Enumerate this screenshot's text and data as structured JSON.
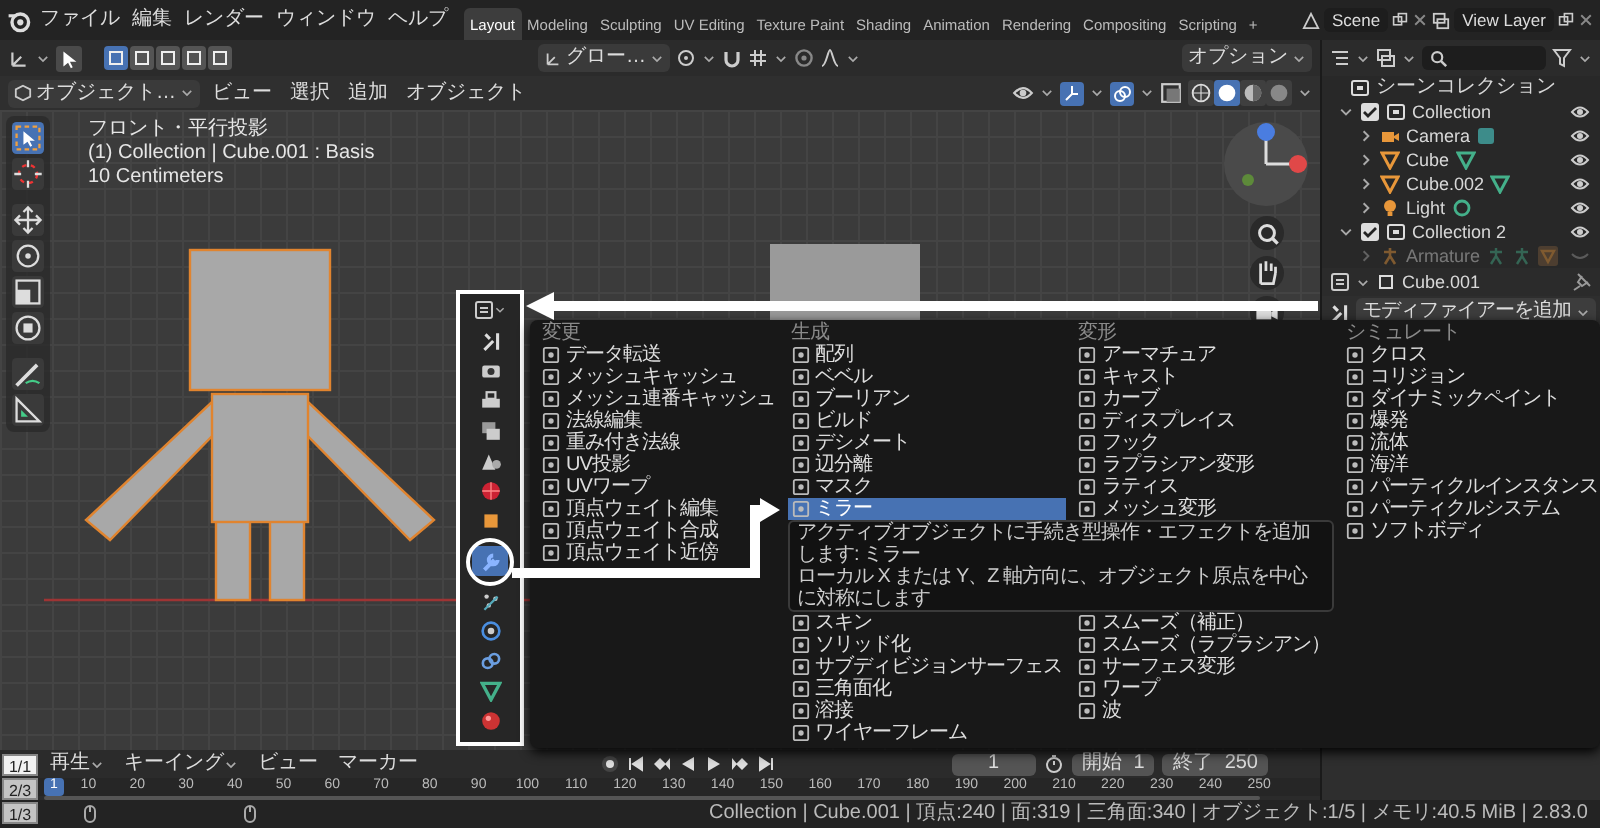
{
  "top_bar": {
    "menus": [
      "ファイル",
      "編集",
      "レンダー",
      "ウィンドウ",
      "ヘルプ"
    ],
    "workspaces": [
      {
        "label": "Layout",
        "selected": true
      },
      {
        "label": "Modeling",
        "selected": false
      },
      {
        "label": "Sculpting",
        "selected": false
      },
      {
        "label": "UV Editing",
        "selected": false
      },
      {
        "label": "Texture Paint",
        "selected": false
      },
      {
        "label": "Shading",
        "selected": false
      },
      {
        "label": "Animation",
        "selected": false
      },
      {
        "label": "Rendering",
        "selected": false
      },
      {
        "label": "Compositing",
        "selected": false
      },
      {
        "label": "Scripting",
        "selected": false
      }
    ],
    "add_workspace": "+",
    "scene": "Scene",
    "view_layer": "View Layer"
  },
  "tool_header": {
    "select_modes": [
      {
        "selected": true
      },
      {
        "selected": false
      },
      {
        "selected": false
      },
      {
        "selected": false
      },
      {
        "selected": false
      }
    ],
    "orientation": "グロー…",
    "options": "オプション"
  },
  "viewport_header": {
    "mode": "オブジェクト…",
    "menus": [
      "ビュー",
      "選択",
      "追加",
      "オブジェクト"
    ],
    "shading": [
      {
        "selected": false
      },
      {
        "selected": true
      },
      {
        "selected": false
      },
      {
        "selected": false
      }
    ]
  },
  "toolbar": [
    {
      "selected": true
    },
    {
      "selected": false
    },
    {
      "selected": false
    },
    {
      "selected": false
    },
    {
      "selected": false
    },
    {
      "selected": false
    },
    {
      "selected": false
    },
    {
      "selected": false
    }
  ],
  "viewport": {
    "info": [
      "フロント・平行投影",
      "(1) Collection | Cube.001 : Basis",
      "10 Centimeters"
    ]
  },
  "outliner": {
    "root": "シーンコレクション",
    "items": [
      {
        "label": "Collection",
        "kind": "collection",
        "checked": true,
        "expanded": true,
        "visible": true,
        "children": [
          {
            "label": "Camera",
            "kind": "camera",
            "expanded": false,
            "visible": true
          },
          {
            "label": "Cube",
            "kind": "mesh",
            "expanded": false,
            "visible": true
          },
          {
            "label": "Cube.002",
            "kind": "mesh",
            "expanded": false,
            "visible": true
          },
          {
            "label": "Light",
            "kind": "light",
            "expanded": false,
            "visible": true
          }
        ]
      },
      {
        "label": "Collection 2",
        "kind": "collection",
        "checked": true,
        "expanded": true,
        "visible": true,
        "children": [
          {
            "label": "Armature",
            "kind": "armature",
            "expanded": false,
            "visible": false
          }
        ]
      }
    ]
  },
  "properties": {
    "object": "Cube.001",
    "add_modifier": "モディファイアーを追加"
  },
  "highlight_tabs": [
    {
      "selected": false
    },
    {
      "selected": false
    },
    {
      "selected": false
    },
    {
      "selected": false
    },
    {
      "selected": false
    },
    {
      "selected": false
    },
    {
      "selected": false
    },
    {
      "selected": true
    },
    {
      "selected": false
    },
    {
      "selected": false
    },
    {
      "selected": false
    },
    {
      "selected": false
    },
    {
      "selected": false
    }
  ],
  "modifier_menu": {
    "columns": [
      {
        "heading": "変更",
        "items": [
          {
            "label": "データ転送",
            "selected": false
          },
          {
            "label": "メッシュキャッシュ",
            "selected": false
          },
          {
            "label": "メッシュ連番キャッシュ",
            "selected": false
          },
          {
            "label": "法線編集",
            "selected": false
          },
          {
            "label": "重み付き法線",
            "selected": false
          },
          {
            "label": "UV投影",
            "selected": false
          },
          {
            "label": "UVワープ",
            "selected": false
          },
          {
            "label": "頂点ウェイト編集",
            "selected": false
          },
          {
            "label": "頂点ウェイト合成",
            "selected": false
          },
          {
            "label": "頂点ウェイト近傍",
            "selected": false
          }
        ]
      },
      {
        "heading": "生成",
        "items": [
          {
            "label": "配列",
            "selected": false
          },
          {
            "label": "ベベル",
            "selected": false
          },
          {
            "label": "ブーリアン",
            "selected": false
          },
          {
            "label": "ビルド",
            "selected": false
          },
          {
            "label": "デシメート",
            "selected": false
          },
          {
            "label": "辺分離",
            "selected": false
          },
          {
            "label": "マスク",
            "selected": false
          },
          {
            "label": "ミラー",
            "selected": true
          }
        ],
        "items_below": [
          {
            "label": "スキン",
            "selected": false
          },
          {
            "label": "ソリッド化",
            "selected": false
          },
          {
            "label": "サブディビジョンサーフェス",
            "selected": false
          },
          {
            "label": "三角面化",
            "selected": false
          },
          {
            "label": "溶接",
            "selected": false
          },
          {
            "label": "ワイヤーフレーム",
            "selected": false
          }
        ]
      },
      {
        "heading": "変形",
        "items": [
          {
            "label": "アーマチュア",
            "selected": false
          },
          {
            "label": "キャスト",
            "selected": false
          },
          {
            "label": "カーブ",
            "selected": false
          },
          {
            "label": "ディスプレイス",
            "selected": false
          },
          {
            "label": "フック",
            "selected": false
          },
          {
            "label": "ラプラシアン変形",
            "selected": false
          },
          {
            "label": "ラティス",
            "selected": false
          },
          {
            "label": "メッシュ変形",
            "selected": false
          }
        ],
        "items_below": [
          {
            "label": "スムーズ（補正）",
            "selected": false
          },
          {
            "label": "スムーズ（ラプラシアン）",
            "selected": false
          },
          {
            "label": "サーフェス変形",
            "selected": false
          },
          {
            "label": "ワープ",
            "selected": false
          },
          {
            "label": "波",
            "selected": false
          }
        ]
      },
      {
        "heading": "シミュレート",
        "items": [
          {
            "label": "クロス",
            "selected": false
          },
          {
            "label": "コリジョン",
            "selected": false
          },
          {
            "label": "ダイナミックペイント",
            "selected": false
          },
          {
            "label": "爆発",
            "selected": false
          },
          {
            "label": "流体",
            "selected": false
          },
          {
            "label": "海洋",
            "selected": false
          },
          {
            "label": "パーティクルインスタンス",
            "selected": false
          },
          {
            "label": "パーティクルシステム",
            "selected": false
          },
          {
            "label": "ソフトボディ",
            "selected": false
          }
        ]
      }
    ],
    "tooltip": [
      "アクティブオブジェクトに手続き型操作・エフェクトを追加します: ミラー",
      "ローカル X または Y、Z 軸方向に、オブジェクト原点を中心に対称にします"
    ]
  },
  "timeline": {
    "menus": [
      {
        "label": "再生",
        "kind": "dropdown"
      },
      {
        "label": "キーイング",
        "kind": "dropdown"
      },
      {
        "label": "ビュー",
        "kind": "menu"
      },
      {
        "label": "マーカー",
        "kind": "menu"
      }
    ],
    "current_frame": "1",
    "start_label": "開始",
    "start": "1",
    "end_label": "終了",
    "end": "250",
    "playhead": "1",
    "ruler": [
      "10",
      "20",
      "30",
      "40",
      "50",
      "60",
      "70",
      "80",
      "90",
      "100",
      "110",
      "120",
      "130",
      "140",
      "150",
      "160",
      "170",
      "180",
      "190",
      "200",
      "210",
      "220",
      "230",
      "240",
      "250"
    ]
  },
  "status_bar": {
    "stats": "Collection | Cube.001 | 頂点:240 | 面:319 | 三角面:340 | オブジェクト:1/5 | メモリ:40.5 MiB | 2.83.0"
  },
  "page_indicators": [
    {
      "label": "1/1",
      "selected": true
    },
    {
      "label": "2/3",
      "selected": false
    },
    {
      "label": "1/3",
      "selected": false
    }
  ]
}
